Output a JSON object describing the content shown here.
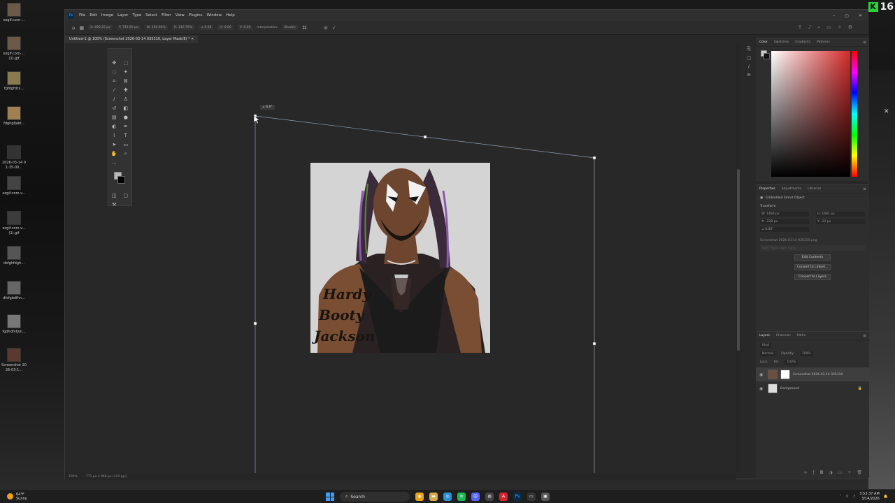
{
  "desktop": {
    "icons": [
      {
        "label": "ezgif.com-..."
      },
      {
        "label": "ezgif.com-... (1).gif"
      },
      {
        "label": "fgfdgfdcs..."
      },
      {
        "label": "fdghgfjakf..."
      },
      {
        "label": "2026-03-14 01-35-00..."
      },
      {
        "label": "ezgif.com-v..."
      },
      {
        "label": "ezgif.com-v... (1).gif"
      },
      {
        "label": "dsfghfdgh..."
      },
      {
        "label": "dfsfgbdfhn..."
      },
      {
        "label": "fgdhdfvfyjn..."
      },
      {
        "label": "Screenshot 2026-03-1..."
      }
    ],
    "kick_badge": {
      "logo": "K",
      "count": "16"
    }
  },
  "photoshop": {
    "menu": [
      "File",
      "Edit",
      "Image",
      "Layer",
      "Type",
      "Select",
      "Filter",
      "View",
      "Plugins",
      "Window",
      "Help"
    ],
    "window_controls": [
      "–",
      "▢",
      "✕"
    ],
    "options_bar": {
      "x": "X: 490.25 px",
      "y": "Y: 735.50 px",
      "w": "W: 100.00%",
      "h": "H: 216.78%",
      "angle": "⊿ 0.00",
      "h_skew": "H: 0.00",
      "v_skew": "V: 0.00",
      "interpolation_label": "Interpolation:",
      "interpolation_value": "Bicubic",
      "cancel_icon": "⊘",
      "commit_icon": "✓"
    },
    "doc_tab": "Untitled-1 @ 100% (Screenshot 2026-03-14 035310, Layer Mask/8) *  ✕",
    "angle_tooltip": "⊿ 6.9°",
    "status_bar": {
      "zoom": "100%",
      "doc_size": "771 px x 968 px (144 ppi)"
    },
    "color_panel": {
      "tabs": [
        "Color",
        "Swatches",
        "Gradients",
        "Patterns"
      ]
    },
    "properties_panel": {
      "tabs": [
        "Properties",
        "Adjustments",
        "Libraries"
      ],
      "object_type": "Embedded Smart Object",
      "section": "Transform",
      "w": "W: 1490 px",
      "h": "H: 1681 px",
      "x": "X: -228 px",
      "y": "Y: -22 px",
      "angle": "⊿ 0.00°",
      "filename": "Screenshot 2026-03-14 035310.png",
      "placeholder": "Don't Apply Layer Comp",
      "buttons": [
        "Edit Contents",
        "Convert to Linked...",
        "Convert to Layers"
      ]
    },
    "layers_panel": {
      "tabs": [
        "Layers",
        "Channels",
        "Paths"
      ],
      "kind": "Kind",
      "blend_mode": "Normal",
      "opacity_label": "Opacity:",
      "opacity_value": "100%",
      "lock_label": "Lock:",
      "fill_label": "Fill:",
      "fill_value": "100%",
      "layers": [
        {
          "name": "Screenshot 2026-03-14 035310",
          "selected": true
        },
        {
          "name": "Background",
          "selected": false
        }
      ]
    },
    "image_tattoo": [
      "Hardy",
      "Booty",
      "Jackson"
    ]
  },
  "taskbar": {
    "weather": {
      "temp": "64°F",
      "condition": "Sunny"
    },
    "search_label": "Search",
    "clock": {
      "time": "3:53:37 AM",
      "date": "3/14/2026"
    },
    "apps": [
      {
        "name": "chrome",
        "glyph": "◉",
        "color": "#e8a31a"
      },
      {
        "name": "files",
        "glyph": "▬",
        "color": "#d9a84a"
      },
      {
        "name": "edge",
        "glyph": "◎",
        "color": "#2a8fd6"
      },
      {
        "name": "spotify",
        "glyph": "≋",
        "color": "#1db954"
      },
      {
        "name": "discord",
        "glyph": "☺",
        "color": "#5865f2"
      },
      {
        "name": "obs",
        "glyph": "◍",
        "color": "#444"
      },
      {
        "name": "acrobat",
        "glyph": "A",
        "color": "#d4252f"
      },
      {
        "name": "photoshop",
        "glyph": "Ps",
        "color": "#0b2b4a"
      },
      {
        "name": "terminal",
        "glyph": "▭",
        "color": "#333"
      },
      {
        "name": "app",
        "glyph": "▣",
        "color": "#555"
      }
    ]
  }
}
